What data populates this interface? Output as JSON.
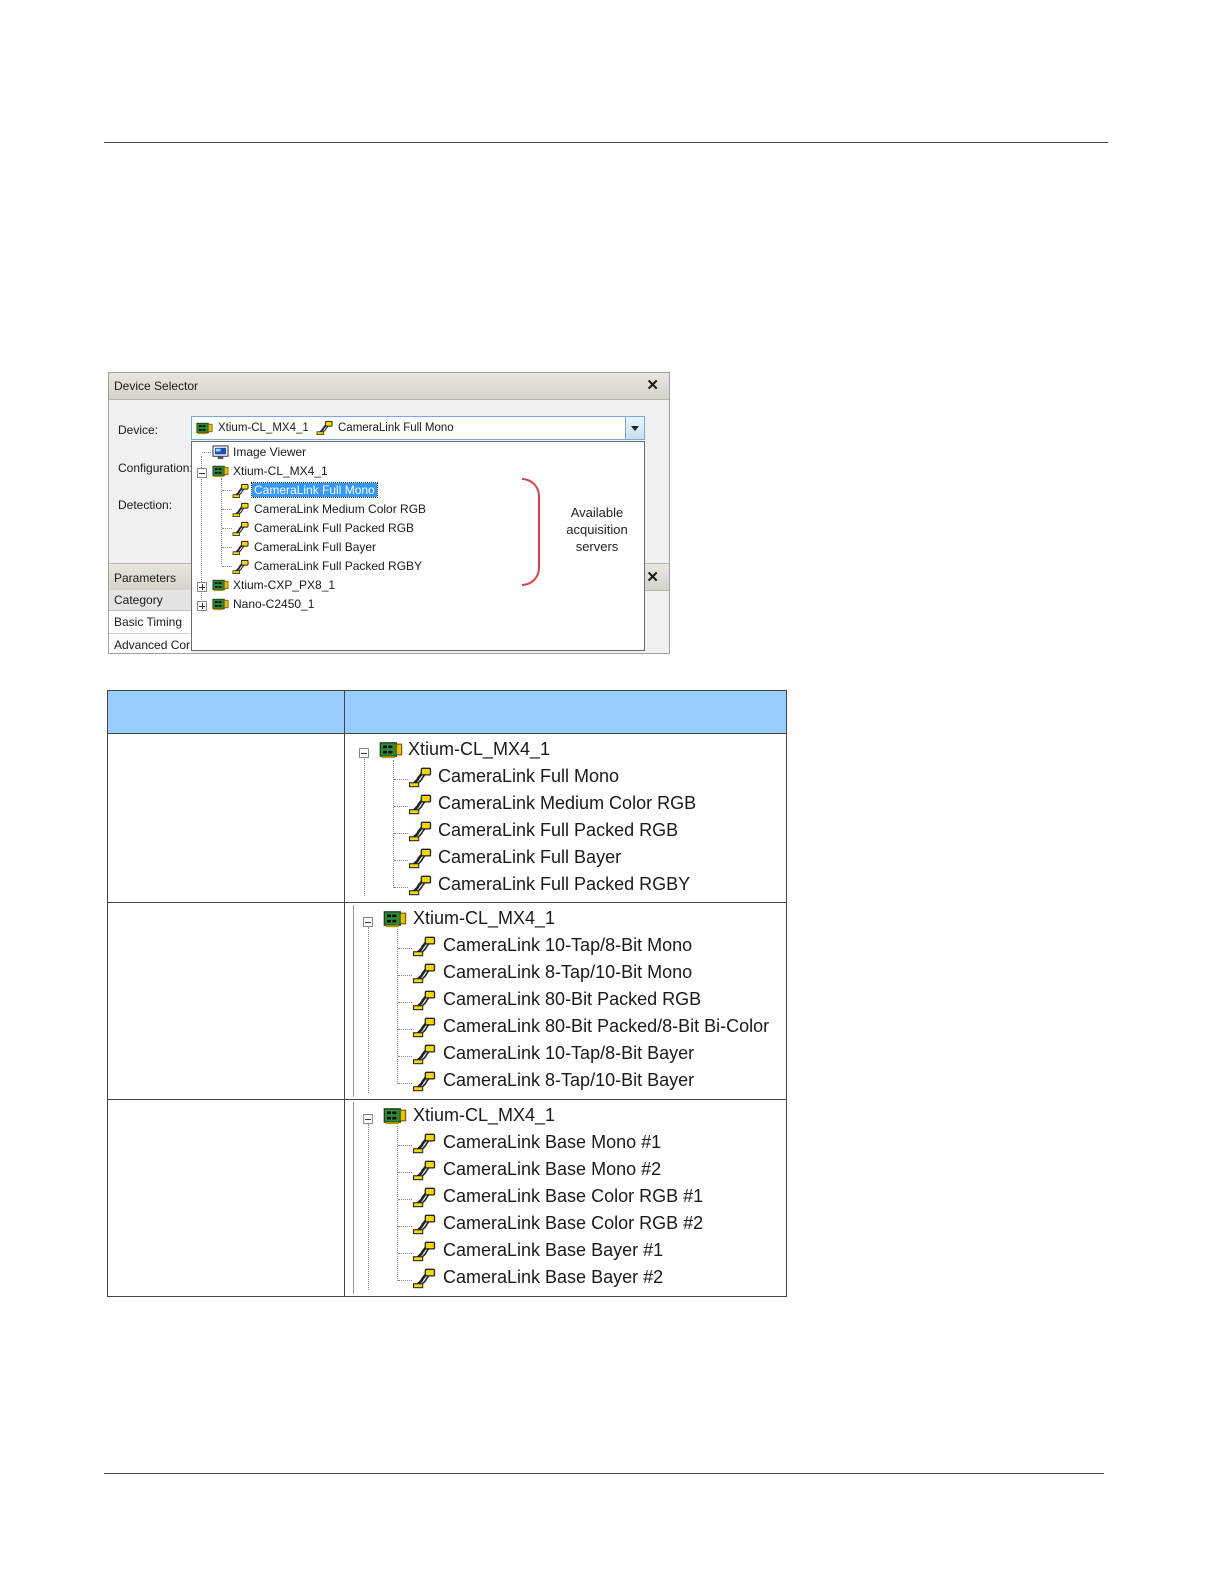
{
  "dialog": {
    "title": "Device Selector",
    "close": "✕",
    "device_label": "Device:",
    "configuration_label": "Configuration:",
    "detection_label": "Detection:",
    "device_value_board": "Xtium-CL_MX4_1",
    "device_value_server": "CameraLink Full Mono",
    "parameters_title": "Parameters",
    "category_header": "Category",
    "category_rows": [
      "Basic Timing",
      "Advanced Cor"
    ],
    "tree": {
      "image_viewer": "Image Viewer",
      "board1": "Xtium-CL_MX4_1",
      "servers": [
        "CameraLink Full Mono",
        "CameraLink Medium Color RGB",
        "CameraLink Full Packed RGB",
        "CameraLink Full Bayer",
        "CameraLink Full Packed RGBY"
      ],
      "board2": "Xtium-CXP_PX8_1",
      "board3": "Nano-C2450_1"
    },
    "annotation": "Available acquisition servers",
    "colors": {
      "selection": "#3399ff",
      "bracket": "#d9414e"
    }
  },
  "table": {
    "header_col1": "",
    "header_col2": "",
    "header_color": "#99ccff",
    "rows": [
      {
        "label": "",
        "board": "Xtium-CL_MX4_1",
        "servers": [
          "CameraLink Full Mono",
          "CameraLink Medium Color RGB",
          "CameraLink Full Packed RGB",
          "CameraLink Full Bayer",
          "CameraLink Full Packed RGBY"
        ]
      },
      {
        "label": "",
        "board": "Xtium-CL_MX4_1",
        "servers": [
          "CameraLink 10-Tap/8-Bit Mono",
          "CameraLink 8-Tap/10-Bit Mono",
          "CameraLink 80-Bit Packed RGB",
          "CameraLink 80-Bit Packed/8-Bit Bi-Color",
          "CameraLink 10-Tap/8-Bit Bayer",
          "CameraLink 8-Tap/10-Bit Bayer"
        ]
      },
      {
        "label": "",
        "board": "Xtium-CL_MX4_1",
        "servers": [
          "CameraLink Base Mono #1",
          "CameraLink Base Mono #2",
          "CameraLink Base Color RGB #1",
          "CameraLink Base Color RGB #2",
          "CameraLink Base Bayer #1",
          "CameraLink Base Bayer #2"
        ]
      }
    ]
  }
}
